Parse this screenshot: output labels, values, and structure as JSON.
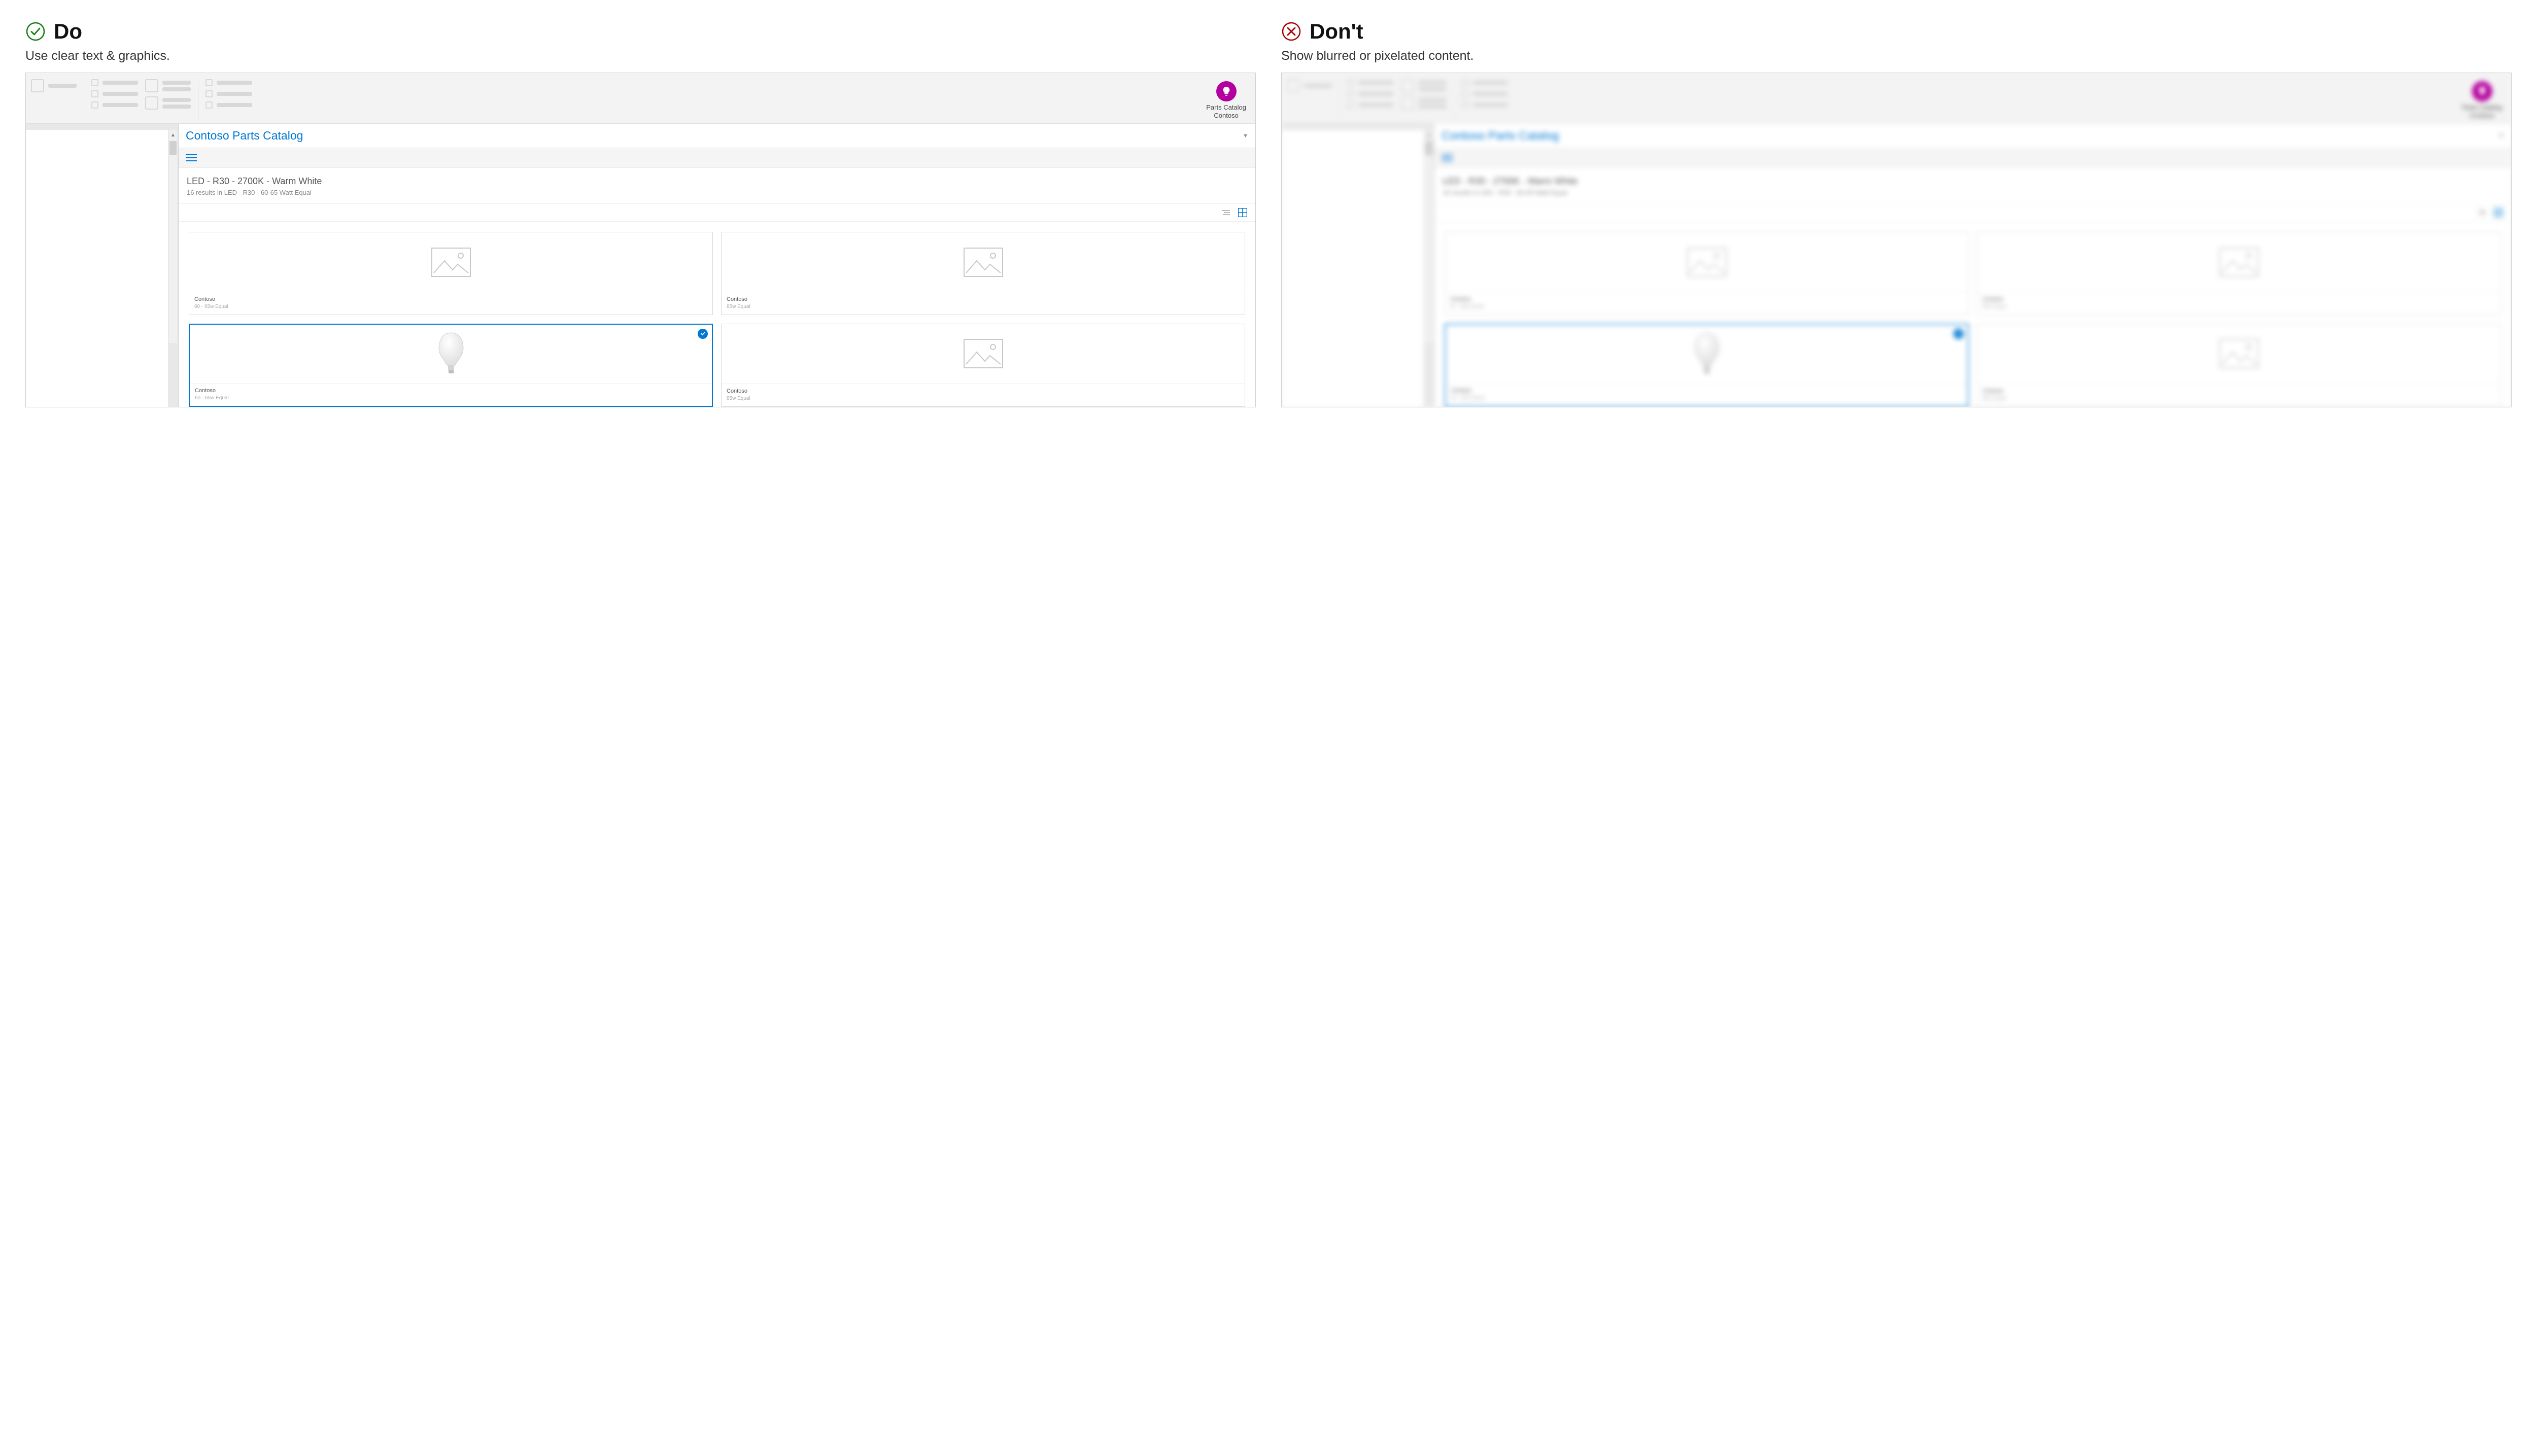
{
  "do": {
    "label": "Do",
    "subtitle": "Use clear text & graphics."
  },
  "dont": {
    "label": "Don't",
    "subtitle": "Show blurred or pixelated content."
  },
  "ribbon": {
    "addin_label_line1": "Parts Catalog",
    "addin_label_line2": "Contoso"
  },
  "pane": {
    "title": "Contoso Parts Catalog",
    "search_title": "LED - R30 - 2700K - Warm White",
    "search_sub": "16 results in LED - R30 - 60-65 Watt Equal"
  },
  "products": [
    {
      "brand": "Contoso",
      "spec": "60 - 65w Equal",
      "selected": false,
      "has_image": false
    },
    {
      "brand": "Contoso",
      "spec": "85w Equal",
      "selected": false,
      "has_image": false
    },
    {
      "brand": "Contoso",
      "spec": "60 - 65w Equal",
      "selected": true,
      "has_image": true
    },
    {
      "brand": "Contoso",
      "spec": "85w Equal",
      "selected": false,
      "has_image": false
    }
  ]
}
